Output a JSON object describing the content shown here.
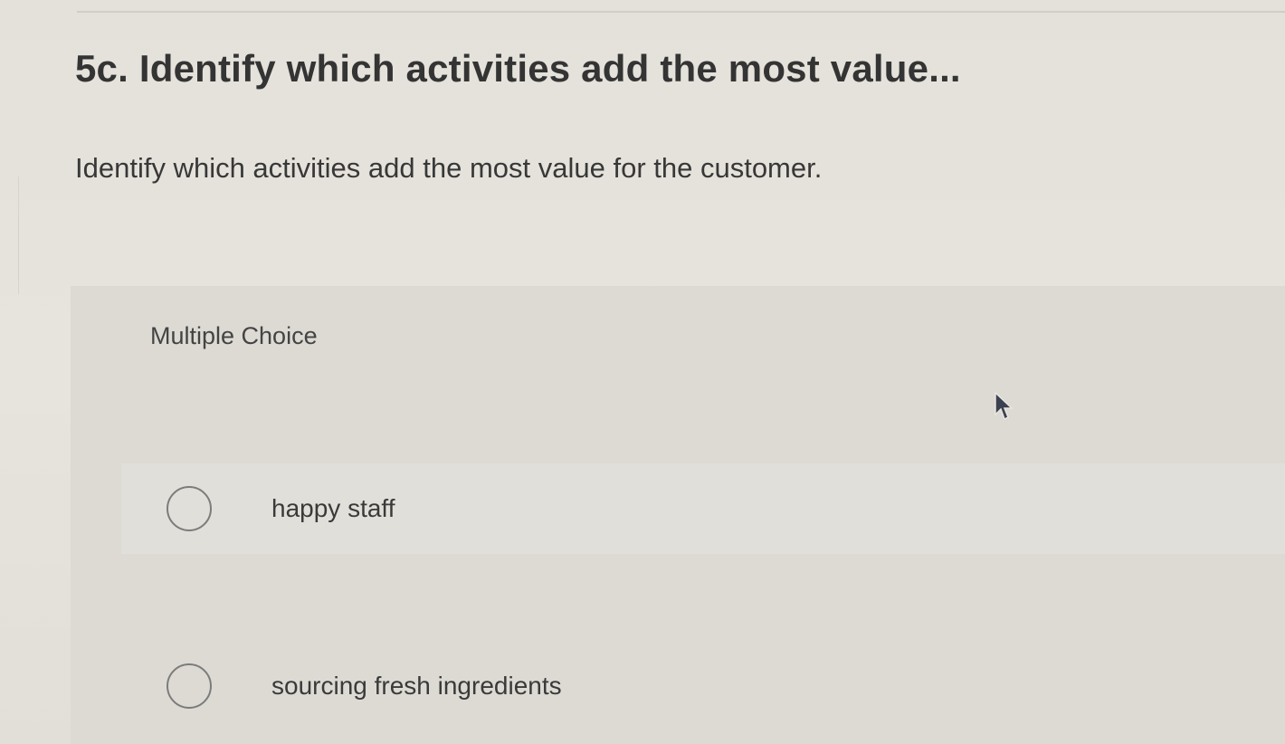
{
  "question": {
    "title": "5c. Identify which activities add the most value...",
    "prompt": "Identify which activities add the most value for the customer."
  },
  "choices": {
    "type_label": "Multiple Choice",
    "options": [
      {
        "label": "happy staff",
        "selected": false
      },
      {
        "label": "sourcing fresh ingredients",
        "selected": false
      }
    ]
  },
  "icons": {
    "cursor": "mouse-pointer-icon",
    "radio": "radio-button-icon"
  }
}
